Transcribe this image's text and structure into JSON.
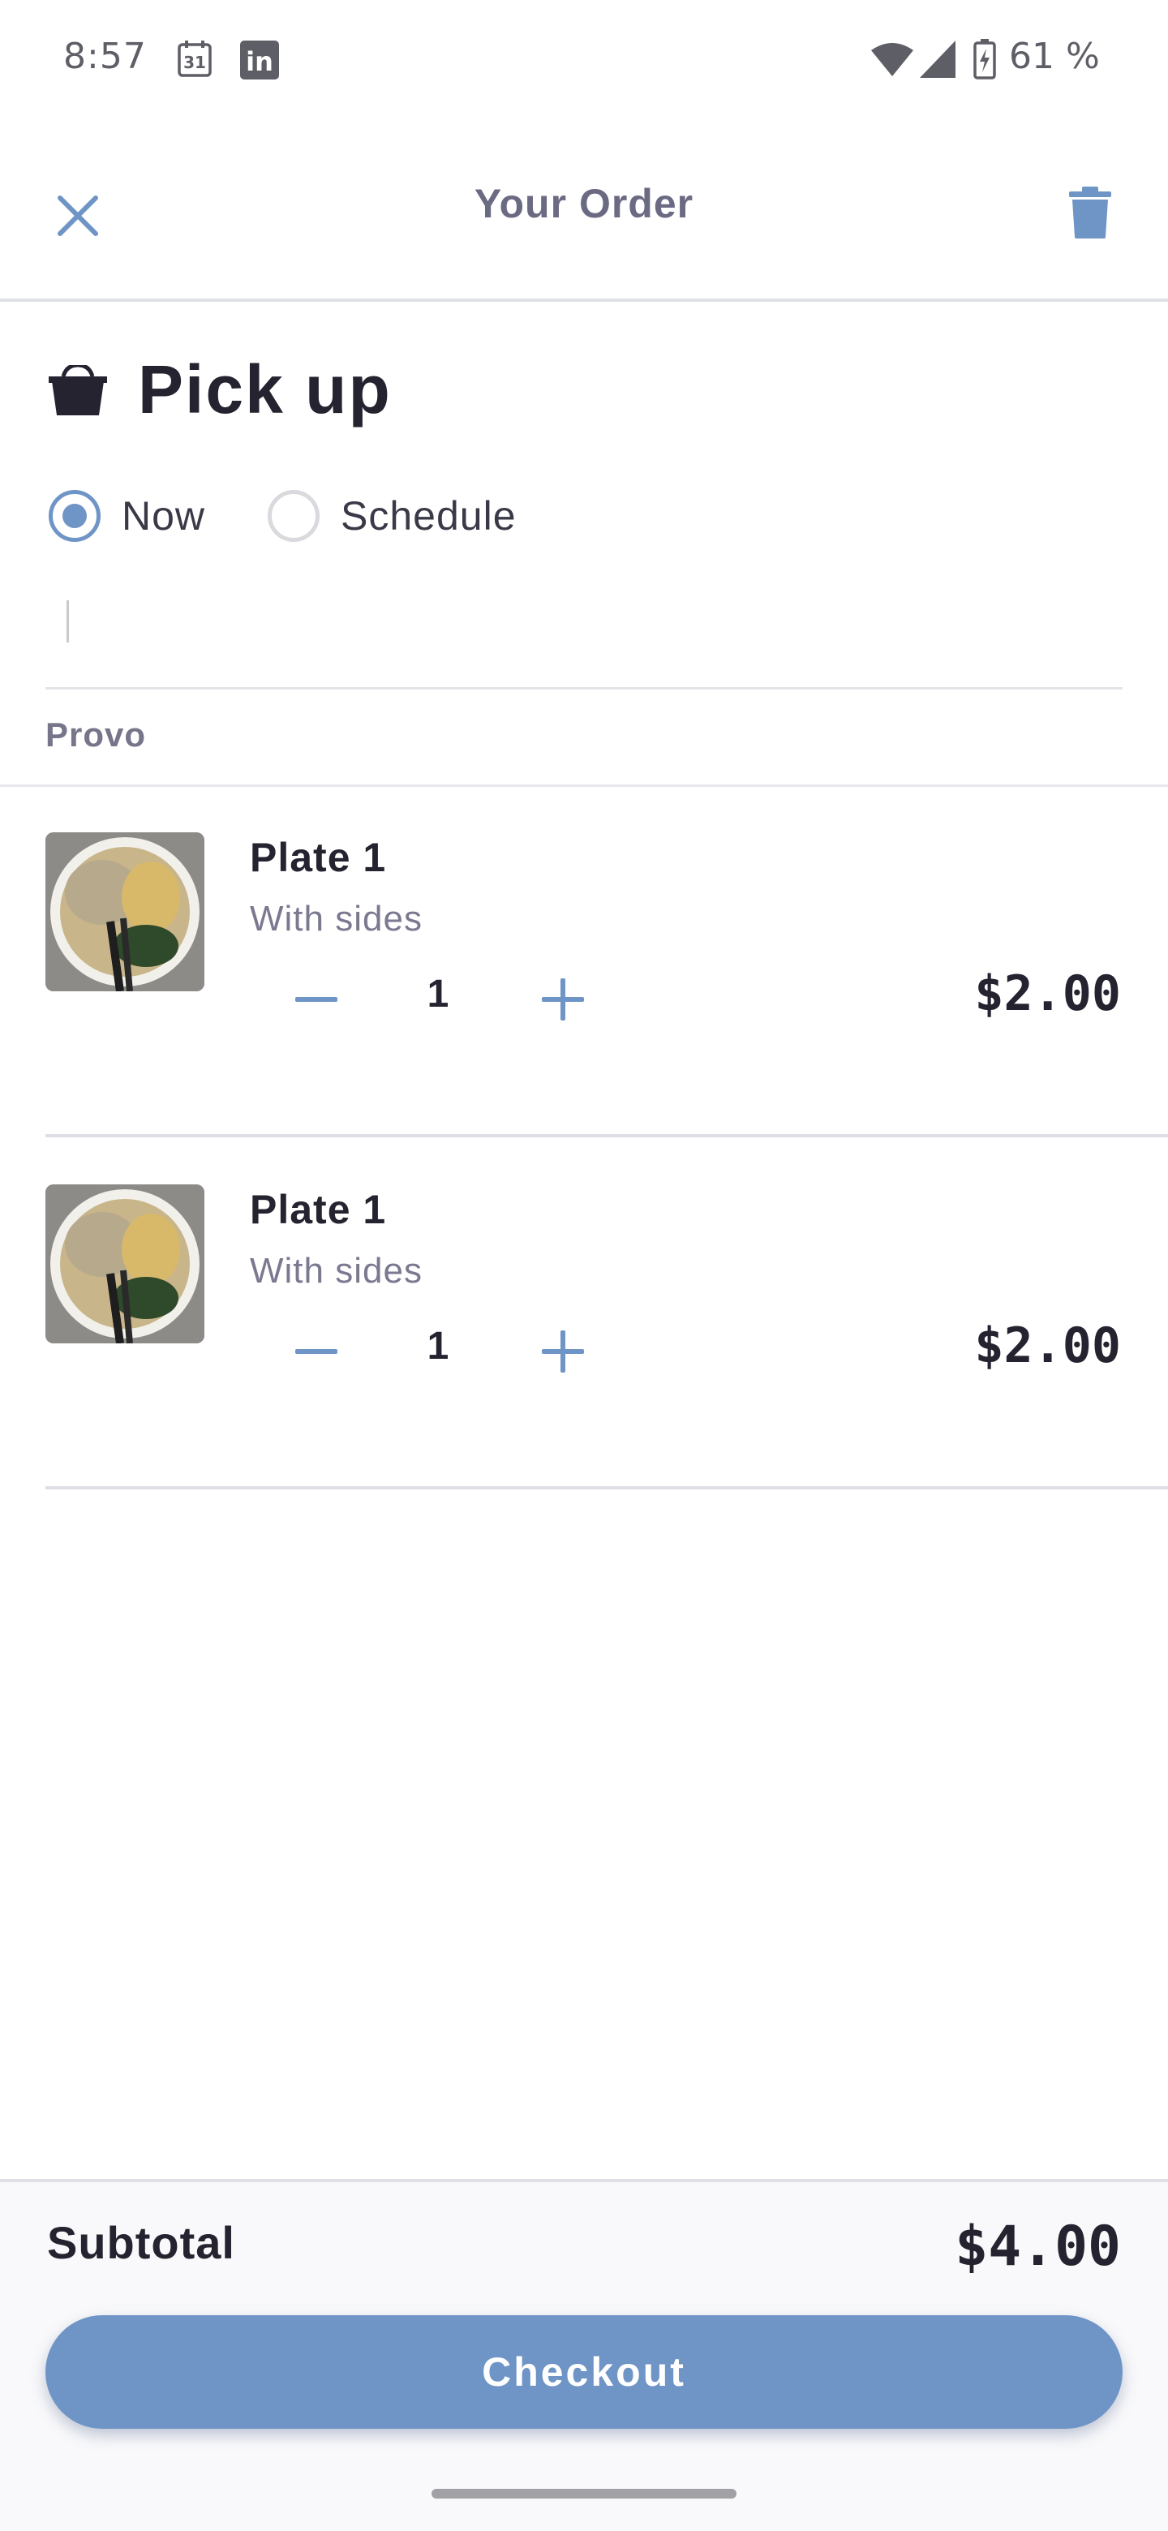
{
  "status_bar": {
    "time": "8:57",
    "calendar_day": "31",
    "linkedin": "in",
    "battery_percent": "61 %"
  },
  "header": {
    "title": "Your Order",
    "close_icon": "close-icon",
    "delete_icon": "trash-icon"
  },
  "pickup": {
    "title": "Pick up",
    "icon": "bag-icon",
    "options": [
      {
        "label": "Now",
        "selected": true
      },
      {
        "label": "Schedule",
        "selected": false
      }
    ]
  },
  "location": {
    "name": "Provo"
  },
  "items": [
    {
      "name": "Plate 1",
      "description": "With sides",
      "quantity": "1",
      "price": "$2.00"
    },
    {
      "name": "Plate 1",
      "description": "With sides",
      "quantity": "1",
      "price": "$2.00"
    }
  ],
  "footer": {
    "subtotal_label": "Subtotal",
    "subtotal_value": "$4.00",
    "checkout_label": "Checkout"
  },
  "colors": {
    "accent": "#6e95c6",
    "text_primary": "#25232f",
    "text_secondary": "#7a7990",
    "divider": "#dfe0e5"
  }
}
